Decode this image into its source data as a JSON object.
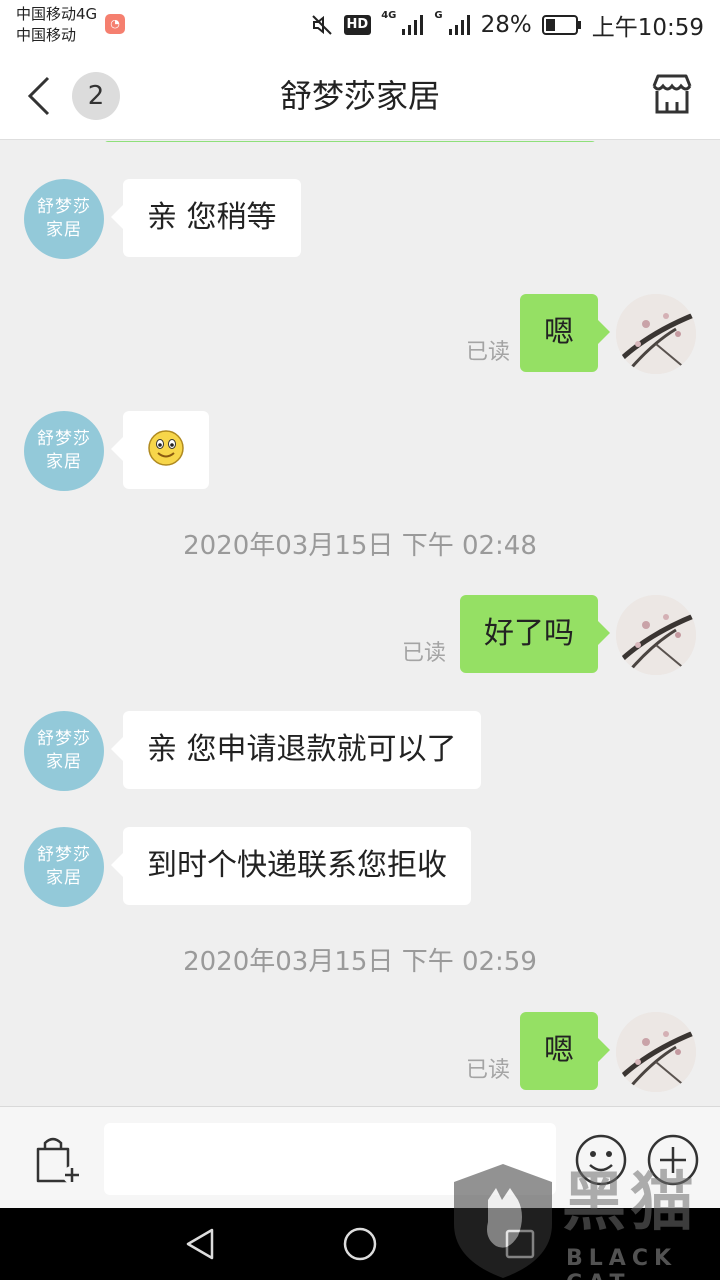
{
  "status_bar": {
    "carrier_line1": "中国移动4G",
    "carrier_line2": "中国移动",
    "hd": "HD",
    "network_label_1": "4G",
    "network_label_2": "G",
    "battery": "28%",
    "time": "上午10:59"
  },
  "header": {
    "unread_count": "2",
    "title": "舒梦莎家居"
  },
  "shop_avatar_text": [
    "舒梦莎",
    "家居"
  ],
  "messages": [
    {
      "from": "shop",
      "text": "亲 您稍等"
    },
    {
      "from": "me",
      "text": "嗯",
      "status": "已读"
    },
    {
      "from": "shop",
      "type": "emoji",
      "icon": "smile-emoji-icon"
    },
    {
      "type": "timestamp",
      "text": "2020年03月15日 下午 02:48"
    },
    {
      "from": "me",
      "text": "好了吗",
      "status": "已读"
    },
    {
      "from": "shop",
      "text": "亲 您申请退款就可以了"
    },
    {
      "from": "shop",
      "text": "到时个快递联系您拒收"
    },
    {
      "type": "timestamp",
      "text": "2020年03月15日 下午 02:59"
    },
    {
      "from": "me",
      "text": "嗯",
      "status": "已读"
    }
  ],
  "input_bar": {
    "placeholder": ""
  },
  "watermark": {
    "text": "黑猫",
    "sub": "BLACK CAT"
  },
  "colors": {
    "outgoing_bubble": "#95e064",
    "incoming_bubble": "#ffffff",
    "shop_avatar": "#93c9d9",
    "chat_background": "#efefef"
  }
}
